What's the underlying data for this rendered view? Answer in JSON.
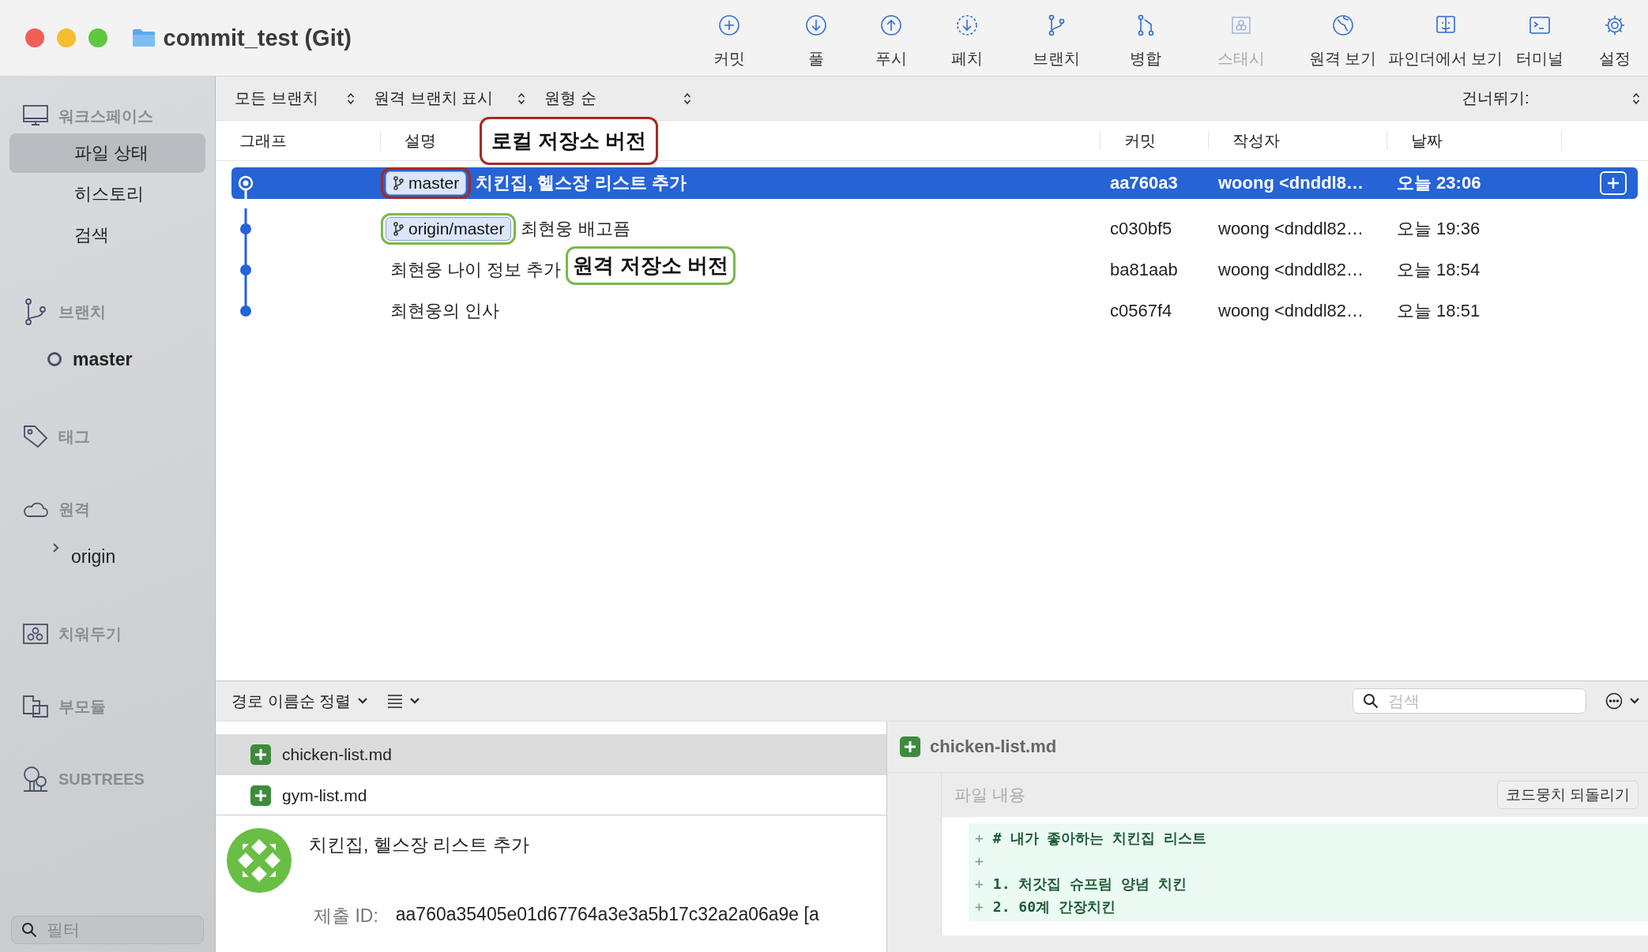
{
  "window": {
    "title": "commit_test (Git)"
  },
  "toolbar": [
    {
      "kind": "commit",
      "label": "커밋",
      "disabled": false
    },
    {
      "kind": "pull",
      "label": "풀",
      "disabled": false
    },
    {
      "kind": "push",
      "label": "푸시",
      "disabled": false
    },
    {
      "kind": "fetch",
      "label": "페치",
      "disabled": false
    },
    {
      "kind": "branch",
      "label": "브랜치",
      "disabled": false
    },
    {
      "kind": "merge",
      "label": "병합",
      "disabled": false
    },
    {
      "kind": "stash",
      "label": "스태시",
      "disabled": true
    },
    {
      "kind": "remote",
      "label": "원격 보기",
      "disabled": false
    },
    {
      "kind": "finder",
      "label": "파인더에서 보기",
      "disabled": false
    },
    {
      "kind": "terminal",
      "label": "터미널",
      "disabled": false
    },
    {
      "kind": "settings",
      "label": "설정",
      "disabled": false
    }
  ],
  "sidebar": {
    "sections": [
      {
        "kind": "workspace",
        "label": "워크스페이스",
        "items": [
          {
            "kind": "view",
            "label": "파일 상태",
            "selected": true
          },
          {
            "kind": "view",
            "label": "히스토리",
            "selected": false
          },
          {
            "kind": "view",
            "label": "검색",
            "selected": false
          }
        ]
      },
      {
        "kind": "branches",
        "label": "브랜치",
        "items": [
          {
            "kind": "branch",
            "label": "master",
            "current": true
          }
        ]
      },
      {
        "kind": "tags",
        "label": "태그"
      },
      {
        "kind": "remotes",
        "label": "원격",
        "items": [
          {
            "kind": "remote",
            "label": "origin",
            "expanded": false
          }
        ]
      },
      {
        "kind": "stashes",
        "label": "치워두기"
      },
      {
        "kind": "submodules",
        "label": "부모듈"
      },
      {
        "kind": "subtrees",
        "label": "SUBTREES"
      }
    ],
    "filter": {
      "placeholder": "필터"
    }
  },
  "filter_bar": {
    "branches": "모든 브랜치",
    "remote_branches": "원격 브랜치 표시",
    "order": "원형 순",
    "jump": "건너뛰기:"
  },
  "table": {
    "columns": [
      "그래프",
      "설명",
      "커밋",
      "작성자",
      "날짜"
    ],
    "rows": [
      {
        "selected": true,
        "tags": [
          {
            "label": "master",
            "color": "#a8291c"
          }
        ],
        "description": "치킨집, 헬스장 리스트 추가",
        "commit": "aa760a3",
        "author": "woong <dnddl8…",
        "date": "오늘 23:06"
      },
      {
        "selected": false,
        "tags": [
          {
            "label": "origin/master",
            "color": "#7cb84a"
          }
        ],
        "description": "최현웅 배고픔",
        "commit": "c030bf5",
        "author": "woong <dnddl82…",
        "date": "오늘 19:36"
      },
      {
        "selected": false,
        "description": "최현웅 나이 정보 추가",
        "annotation": {
          "text": "원격 저장소 버전",
          "color": "#7cb84a"
        },
        "commit": "ba81aab",
        "author": "woong <dnddl82…",
        "date": "오늘 18:54"
      },
      {
        "selected": false,
        "description": "최현웅의 인사",
        "commit": "c0567f4",
        "author": "woong <dnddl82…",
        "date": "오늘 18:51"
      }
    ]
  },
  "annotations": [
    {
      "text": "로컬 저장소 버전",
      "color": "#a8291c"
    }
  ],
  "file_list": {
    "sort": "경로 이름순 정렬",
    "files": [
      {
        "name": "chicken-list.md",
        "selected": true
      },
      {
        "name": "gym-list.md",
        "selected": false
      }
    ]
  },
  "commit_detail": {
    "message": "치킨집, 헬스장 리스트 추가",
    "id_label": "제출 ID:",
    "id": "aa760a35405e01d67764a3e3a5b17c32a2a06a9e [a"
  },
  "diff": {
    "search_placeholder": "검색",
    "file": "chicken-list.md",
    "header": "파일 내용",
    "revert": "코드뭉치 되돌리기",
    "lines": [
      {
        "prefix": "+",
        "text": "# 내가 좋아하는 치킨집 리스트"
      },
      {
        "prefix": "+"
      },
      {
        "prefix": "+",
        "text": "1. 처갓집 슈프림 양념 치킨"
      },
      {
        "prefix": "+",
        "text": "2. 60계 간장치킨"
      }
    ]
  }
}
